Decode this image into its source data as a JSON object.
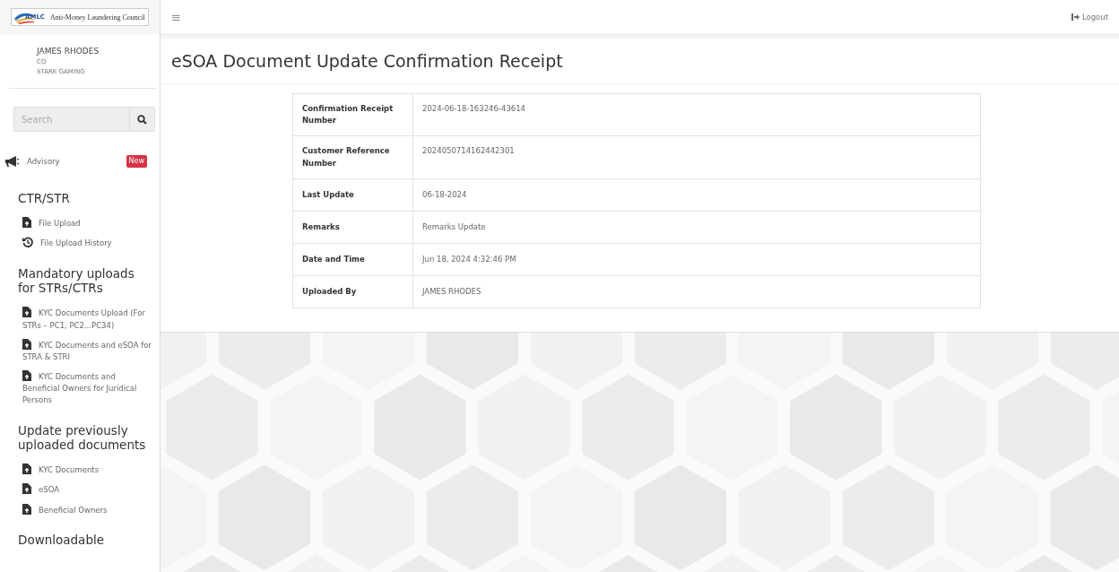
{
  "logo": {
    "mark": "AMLC",
    "name": "Anti-Money Laundering Council"
  },
  "user": {
    "name": "JAMES RHODES",
    "role": "CO",
    "company": "STARK GAMING"
  },
  "search": {
    "placeholder": "Search"
  },
  "sidebar": {
    "items": [
      {
        "kind": "advisory",
        "label": "Advisory",
        "badge": "New"
      },
      {
        "kind": "heading",
        "label": "CTR/STR"
      },
      {
        "kind": "file",
        "label": "File Upload"
      },
      {
        "kind": "history",
        "label": "File Upload History"
      },
      {
        "kind": "heading",
        "label": "Mandatory uploads for STRs/CTRs"
      },
      {
        "kind": "file",
        "label": "KYC Documents Upload (For STRs – PC1, PC2...PC34)"
      },
      {
        "kind": "file",
        "label": "KYC Documents and eSOA for STRA & STRI"
      },
      {
        "kind": "file",
        "label": "KYC Documents and Beneficial Owners for Juridical Persons"
      },
      {
        "kind": "heading",
        "label": "Update previously uploaded documents"
      },
      {
        "kind": "file",
        "label": "KYC Documents"
      },
      {
        "kind": "file",
        "label": "eSOA"
      },
      {
        "kind": "file",
        "label": "Beneficial Owners"
      },
      {
        "kind": "heading",
        "label": "Downloadable"
      }
    ]
  },
  "topbar": {
    "menu": "≡",
    "logout": "Logout"
  },
  "page": {
    "title": "eSOA Document Update Confirmation Receipt"
  },
  "table": {
    "rows": [
      {
        "label": "Confirmation Receipt Number",
        "value": "2024-06-18-163246-43614"
      },
      {
        "label": "Customer Reference Number",
        "value": "2024050714162442301"
      },
      {
        "label": "Last Update",
        "value": "06-18-2024"
      },
      {
        "label": "Remarks",
        "value": "Remarks Update"
      },
      {
        "label": "Date and Time",
        "value": "Jun 18, 2024 4:32:46 PM"
      },
      {
        "label": "Uploaded By",
        "value": "JAMES RHODES"
      }
    ]
  }
}
